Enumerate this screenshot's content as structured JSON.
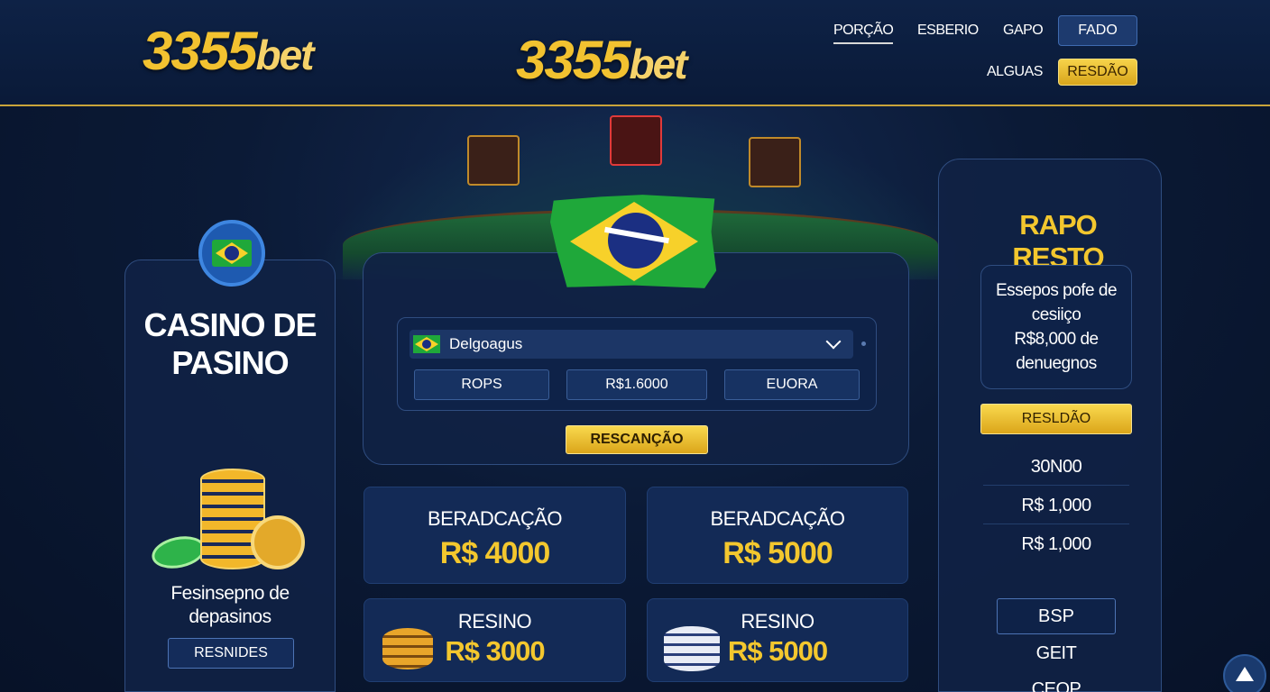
{
  "header": {
    "logo_primary": {
      "num": "3355",
      "bet": "bet"
    },
    "logo_secondary": {
      "num": "3355",
      "bet": "bet"
    },
    "nav": [
      "PORÇÃO",
      "ESBERIO",
      "GAPO"
    ],
    "nav_button": "FADO",
    "nav_secondary": "ALGUAS",
    "nav_cta": "RESDÃO"
  },
  "left_panel": {
    "title_line1": "CASINO DE",
    "title_line2": "PASINO",
    "caption_line1": "Fesinsepno de",
    "caption_line2": "depasinos",
    "button": "RESNIDES"
  },
  "deposit_form": {
    "selected_country": "Delgoagus",
    "options": [
      "ROPS",
      "R$1.6000",
      "EUORA"
    ],
    "submit": "RESCANÇÃO"
  },
  "cards": [
    {
      "title": "BERADCAÇÃO",
      "value": "R$ 4000"
    },
    {
      "title": "BERADCAÇÃO",
      "value": "R$ 5000"
    },
    {
      "title": "RESINO",
      "value": "R$ 3000"
    },
    {
      "title": "RESINO",
      "value": "R$ 5000"
    }
  ],
  "right_panel": {
    "title": "RAPO RESTO",
    "info_line1": "Essepos pofe de",
    "info_line2": "cesiiço",
    "info_line3": "R$8,000 de",
    "info_line4": "denuegnos",
    "button": "RESLDÃO",
    "rows": [
      "30N00",
      "R$ 1,000",
      "R$ 1,000"
    ],
    "button2": "BSP",
    "footer1": "GEIT",
    "footer2": "CEOP"
  },
  "colors": {
    "accent_gold": "#f3c72e",
    "brand_navy": "#0b1a36",
    "flag_green": "#1fa83a"
  }
}
